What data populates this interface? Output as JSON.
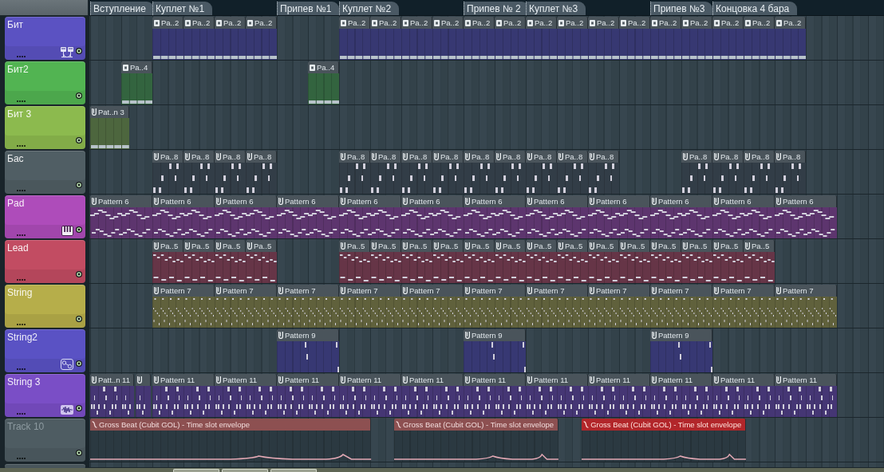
{
  "markers": [
    "Вступление",
    "Куплет №1",
    "Припев №1",
    "Куплет №2",
    "Припев № 2",
    "Куплет №3",
    "Припев №3",
    "Концовка 4 бара"
  ],
  "tracks": [
    {
      "name": "Бит",
      "color": "#5b52c2",
      "kind": "steps",
      "dimmed": false,
      "on": true,
      "clips": [
        {
          "name": "Pa..2"
        },
        {
          "name": "Pa..2"
        },
        {
          "name": "Pa..2"
        },
        {
          "name": "Pa..2"
        },
        {
          "name": "Pa..2"
        },
        {
          "name": "Pa..2"
        },
        {
          "name": "Pa..2"
        },
        {
          "name": "Pa..2"
        },
        {
          "name": "Pa..2"
        },
        {
          "name": "Pa..2"
        },
        {
          "name": "Pa..2"
        },
        {
          "name": "Pa..2"
        },
        {
          "name": "Pa..2"
        },
        {
          "name": "Pa..2"
        },
        {
          "name": "Pa..2"
        },
        {
          "name": "Pa..2"
        },
        {
          "name": "Pa..2"
        },
        {
          "name": "Pa..2"
        },
        {
          "name": "Pa..2"
        }
      ]
    },
    {
      "name": "Бит2",
      "color": "#52b452",
      "kind": "steps",
      "dimmed": false,
      "on": true,
      "clips": [
        {
          "name": "Pa..4"
        },
        {
          "name": "Pa..4"
        }
      ]
    },
    {
      "name": "Бит 3",
      "color": "#8cba4e",
      "kind": "beat",
      "dimmed": false,
      "on": true,
      "clips": [
        {
          "name": "Pat..n 3"
        }
      ]
    },
    {
      "name": "Бас",
      "color": "#505e64",
      "kind": "notes",
      "dimmed": false,
      "on": true,
      "clips": [
        {
          "name": "Pa..8"
        },
        {
          "name": "Pa..8"
        },
        {
          "name": "Pa..8"
        },
        {
          "name": "Pa..8"
        },
        {
          "name": "Pa..8"
        },
        {
          "name": "Pa..8"
        },
        {
          "name": "Pa..8"
        },
        {
          "name": "Pa..8"
        },
        {
          "name": "Pa..8"
        },
        {
          "name": "Pa..8"
        },
        {
          "name": "Pa..8"
        },
        {
          "name": "Pa..8"
        },
        {
          "name": "Pa..8"
        },
        {
          "name": "Pa..8"
        },
        {
          "name": "Pa..8"
        },
        {
          "name": "Pa..8"
        },
        {
          "name": "Pa..8"
        }
      ]
    },
    {
      "name": "Pad",
      "color": "#ae4cba",
      "kind": "notes",
      "dimmed": false,
      "on": true,
      "clips": [
        {
          "name": "Pattern 6"
        },
        {
          "name": "Pattern 6"
        },
        {
          "name": "Pattern 6"
        },
        {
          "name": "Pattern 6"
        },
        {
          "name": "Pattern 6"
        },
        {
          "name": "Pattern 6"
        },
        {
          "name": "Pattern 6"
        },
        {
          "name": "Pattern 6"
        },
        {
          "name": "Pattern 6"
        },
        {
          "name": "Pattern 6"
        },
        {
          "name": "Pattern 6"
        },
        {
          "name": "Pattern 6"
        }
      ]
    },
    {
      "name": "Lead",
      "color": "#c24c62",
      "kind": "notes",
      "dimmed": false,
      "on": true,
      "clips": [
        {
          "name": "Pa..5"
        },
        {
          "name": "Pa..5"
        },
        {
          "name": "Pa..5"
        },
        {
          "name": "Pa..5"
        },
        {
          "name": "Pa..5"
        },
        {
          "name": "Pa..5"
        },
        {
          "name": "Pa..5"
        },
        {
          "name": "Pa..5"
        },
        {
          "name": "Pa..5"
        },
        {
          "name": "Pa..5"
        },
        {
          "name": "Pa..5"
        },
        {
          "name": "Pa..5"
        },
        {
          "name": "Pa..5"
        },
        {
          "name": "Pa..5"
        },
        {
          "name": "Pa..5"
        },
        {
          "name": "Pa..5"
        },
        {
          "name": "Pa..5"
        },
        {
          "name": "Pa..5"
        }
      ]
    },
    {
      "name": "String",
      "color": "#b6ae4a",
      "kind": "notes",
      "dimmed": false,
      "on": true,
      "clips": [
        {
          "name": "Pattern 7"
        },
        {
          "name": "Pattern 7"
        },
        {
          "name": "Pattern 7"
        },
        {
          "name": "Pattern 7"
        },
        {
          "name": "Pattern 7"
        },
        {
          "name": "Pattern 7"
        },
        {
          "name": "Pattern 7"
        },
        {
          "name": "Pattern 7"
        },
        {
          "name": "Pattern 7"
        },
        {
          "name": "Pattern 7"
        },
        {
          "name": "Pattern 7"
        }
      ]
    },
    {
      "name": "String2",
      "color": "#5a52c4",
      "kind": "notes",
      "dimmed": false,
      "on": true,
      "clips": [
        {
          "name": "Pattern 9"
        },
        {
          "name": "Pattern 9"
        },
        {
          "name": "Pattern 9"
        }
      ]
    },
    {
      "name": "String 3",
      "color": "#7a4ec6",
      "kind": "notes",
      "dimmed": false,
      "on": true,
      "clips": [
        {
          "kind": "pattern",
          "name": "Patt..n 11"
        },
        {
          "kind": "stub"
        },
        {
          "kind": "pattern",
          "name": "Pattern 11"
        },
        {
          "kind": "pattern",
          "name": "Pattern 11"
        },
        {
          "kind": "pattern",
          "name": "Pattern 11"
        },
        {
          "kind": "pattern",
          "name": "Pattern 11"
        },
        {
          "kind": "pattern",
          "name": "Pattern 11"
        },
        {
          "kind": "pattern",
          "name": "Pattern 11"
        },
        {
          "kind": "pattern",
          "name": "Pattern 11"
        },
        {
          "kind": "pattern",
          "name": "Pattern 11"
        },
        {
          "kind": "pattern",
          "name": "Pattern 11"
        },
        {
          "kind": "pattern",
          "name": "Pattern 11"
        },
        {
          "kind": "pattern",
          "name": "Pattern 11"
        }
      ]
    },
    {
      "name": "Track 10",
      "color": "#4e5c62",
      "kind": "automation",
      "dimmed": true,
      "on": true,
      "clips": [
        {
          "name": "Gross Beat (Cubit GOL) - Time slot envelope",
          "selected": false
        },
        {
          "name": "Gross Beat (Cubit GOL) - Time slot envelope",
          "selected": false
        },
        {
          "name": "Gross Beat (Cubit GOL) - Time slot envelope",
          "selected": true
        }
      ]
    },
    {
      "color": "#4e5c62"
    }
  ]
}
